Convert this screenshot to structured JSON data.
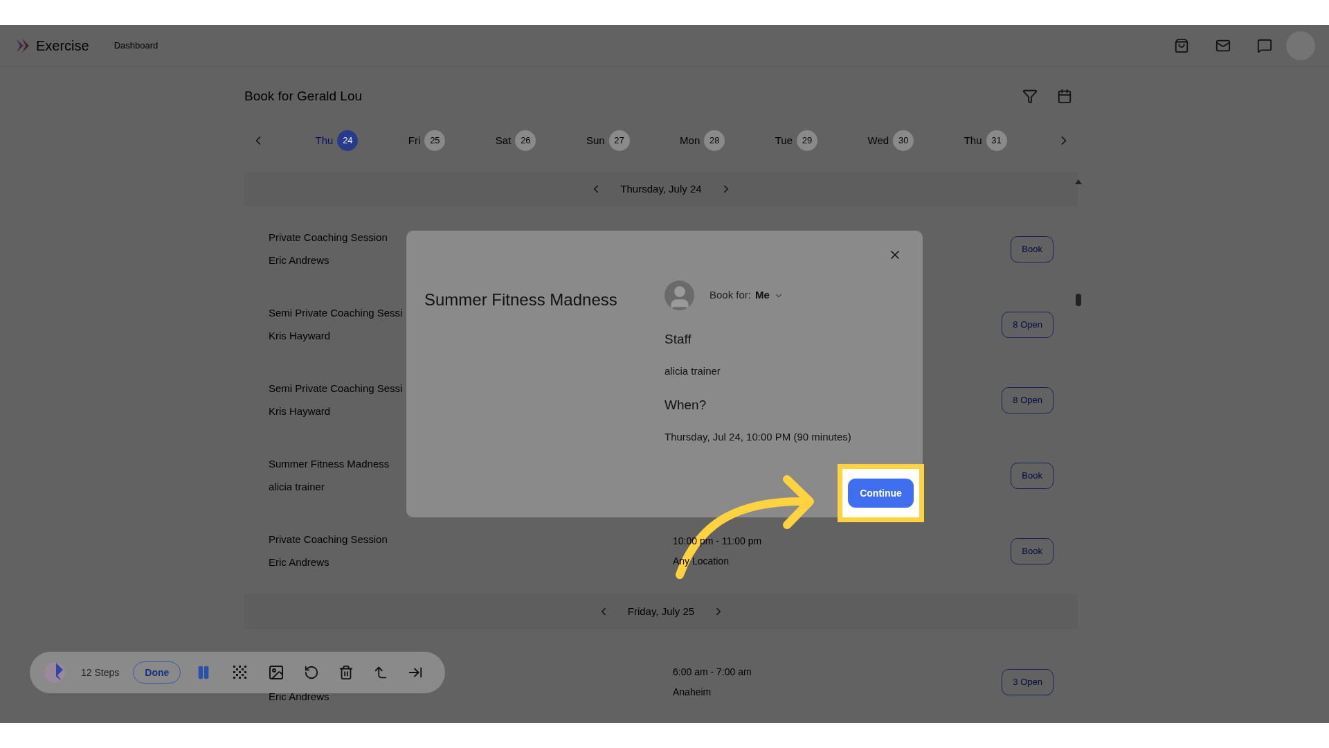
{
  "header": {
    "app_name": "Exercise",
    "nav_link": "Dashboard"
  },
  "page": {
    "title": "Book for Gerald Lou"
  },
  "days": [
    {
      "weekday": "Thu",
      "date": "24",
      "selected": true
    },
    {
      "weekday": "Fri",
      "date": "25",
      "selected": false
    },
    {
      "weekday": "Sat",
      "date": "26",
      "selected": false
    },
    {
      "weekday": "Sun",
      "date": "27",
      "selected": false
    },
    {
      "weekday": "Mon",
      "date": "28",
      "selected": false
    },
    {
      "weekday": "Tue",
      "date": "29",
      "selected": false
    },
    {
      "weekday": "Wed",
      "date": "30",
      "selected": false
    },
    {
      "weekday": "Thu",
      "date": "31",
      "selected": false
    }
  ],
  "sections": [
    {
      "label": "Thursday, July 24",
      "sessions": [
        {
          "title": "Private Coaching Session",
          "staff": "Eric Andrews",
          "action": "Book"
        },
        {
          "title": "Semi Private Coaching Sessi",
          "staff": "Kris Hayward",
          "action": "8 Open"
        },
        {
          "title": "Semi Private Coaching Sessi",
          "staff": "Kris Hayward",
          "action": "8 Open"
        },
        {
          "title": "Summer Fitness Madness",
          "staff": "alicia trainer",
          "action": "Book"
        },
        {
          "title": "Private Coaching Session",
          "staff": "Eric Andrews",
          "time": "10:00 pm - 11:00 pm",
          "location": "Any Location",
          "action": "Book"
        }
      ]
    },
    {
      "label": "Friday, July 25",
      "sessions": [
        {
          "staff": "Eric Andrews",
          "time": "6:00 am - 7:00 am",
          "location": "Anaheim",
          "action": "3 Open"
        }
      ]
    }
  ],
  "modal": {
    "title": "Summer Fitness Madness",
    "book_for_label": "Book for:",
    "book_for_value": "Me",
    "staff_heading": "Staff",
    "staff": "alicia trainer",
    "when_heading": "When?",
    "when": "Thursday, Jul 24, 10:00 PM (90 minutes)",
    "button": "Continue"
  },
  "recorder": {
    "steps": "12 Steps",
    "done": "Done"
  }
}
